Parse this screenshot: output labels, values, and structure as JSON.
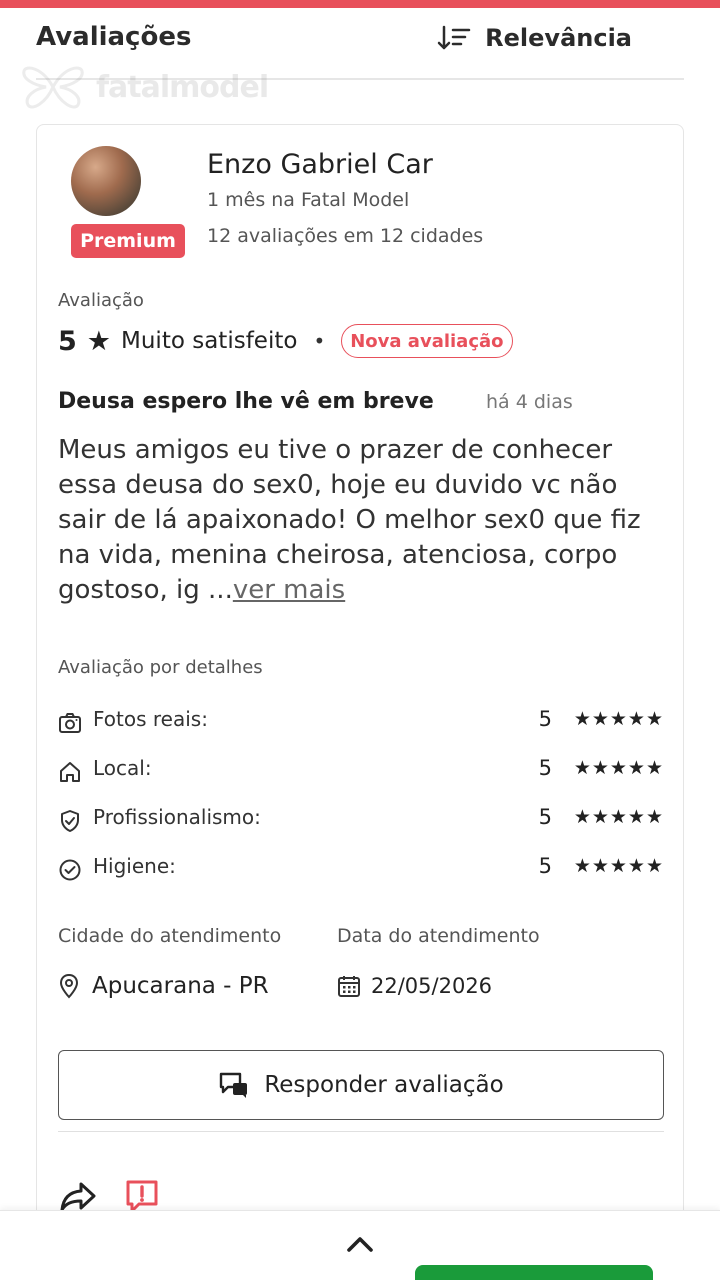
{
  "header": {
    "title": "Avaliações",
    "sort_label": "Relevância"
  },
  "watermark": {
    "text": "fatalmodel"
  },
  "reviewer": {
    "name": "Enzo Gabriel Car",
    "since": "1 mês na Fatal Model",
    "count": "12 avaliações em 12 cidades",
    "badge": "Premium"
  },
  "evaluation": {
    "label": "Avaliação",
    "score": "5",
    "star": "★",
    "text": "Muito satisfeito",
    "separator": "•",
    "new_badge": "Nova avaliação"
  },
  "review": {
    "title": "Deusa espero lhe vê em breve",
    "date": "há 4 dias",
    "body": "Meus amigos eu tive o prazer de conhecer essa deusa do sex0, hoje eu duvido vc não sair de lá apaixonado! O melhor sex0 que fiz na vida, menina cheirosa, atenciosa, corpo gostoso, ig ...",
    "more_label": "ver mais"
  },
  "details": {
    "label": "Avaliação por detalhes",
    "items": [
      {
        "name": "Fotos reais:",
        "score": "5",
        "stars": "★★★★★",
        "icon": "camera-icon"
      },
      {
        "name": "Local:",
        "score": "5",
        "stars": "★★★★★",
        "icon": "home-icon"
      },
      {
        "name": "Profissionalismo:",
        "score": "5",
        "stars": "★★★★★",
        "icon": "shield-check-icon"
      },
      {
        "name": "Higiene:",
        "score": "5",
        "stars": "★★★★★",
        "icon": "check-circle-icon"
      }
    ]
  },
  "service": {
    "city_label": "Cidade do atendimento",
    "city_value": "Apucarana - PR",
    "date_label": "Data do atendimento",
    "date_value": "22/05/2026"
  },
  "actions": {
    "respond_label": "Responder avaliação"
  },
  "colors": {
    "accent": "#e8505b",
    "green": "#1a9b3a"
  }
}
